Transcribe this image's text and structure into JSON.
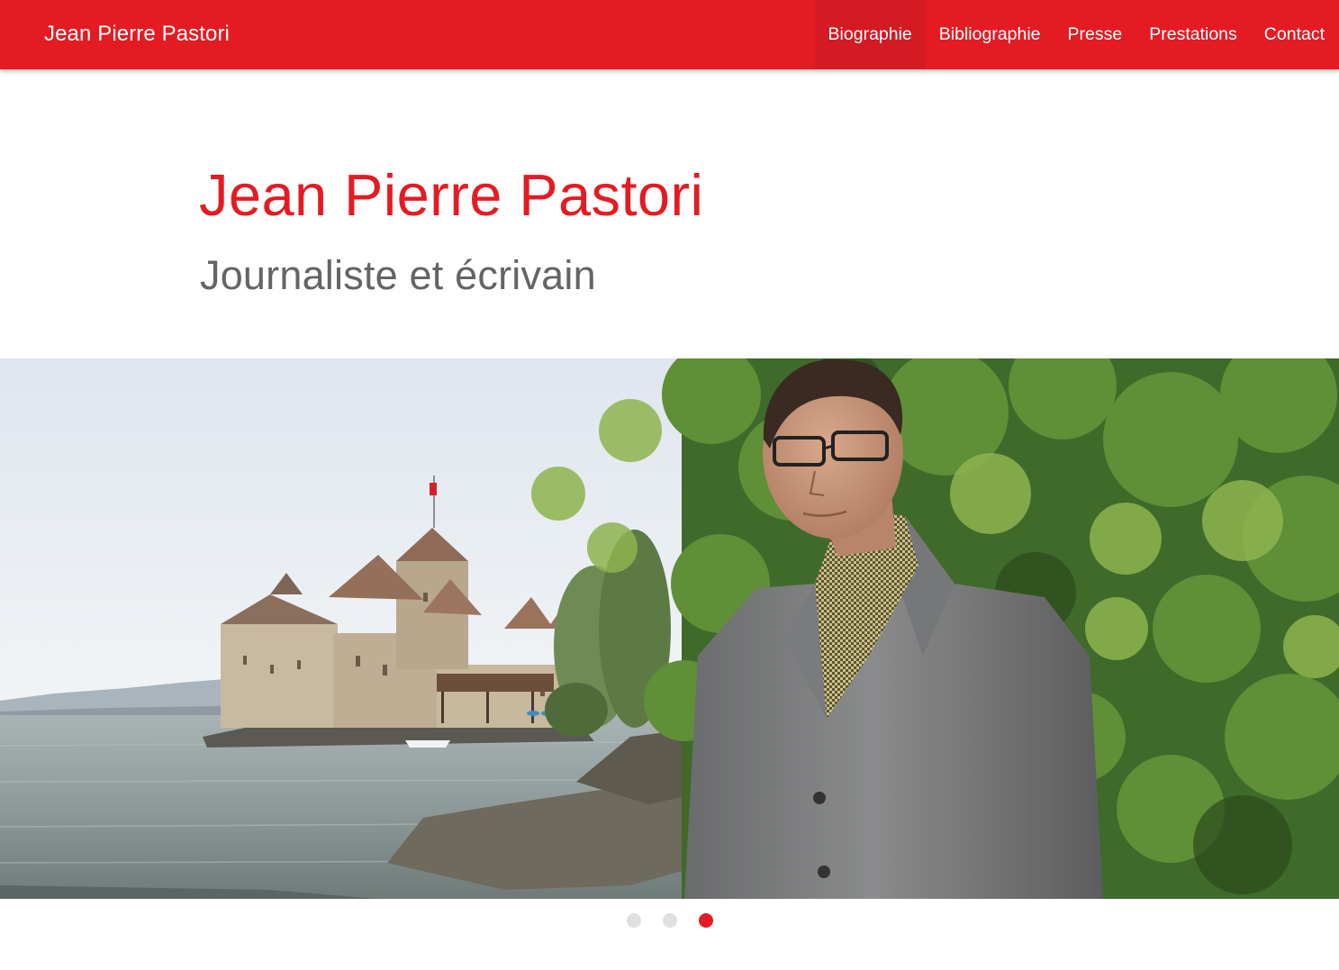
{
  "header": {
    "brand": "Jean Pierre Pastori",
    "nav": [
      {
        "label": "Biographie",
        "active": true
      },
      {
        "label": "Bibliographie",
        "active": false
      },
      {
        "label": "Presse",
        "active": false
      },
      {
        "label": "Prestations",
        "active": false
      },
      {
        "label": "Contact",
        "active": false
      }
    ]
  },
  "hero": {
    "title": "Jean Pierre Pastori",
    "subtitle": "Journaliste et écrivain"
  },
  "carousel": {
    "slide_count": 3,
    "active_index": 2,
    "image_icon": "portrait-photo-chillon-castle"
  },
  "colors": {
    "brand_red": "#e41b23",
    "active_nav": "#d41a22",
    "subtitle_gray": "#646464",
    "dot_inactive": "#e0e0e0"
  }
}
